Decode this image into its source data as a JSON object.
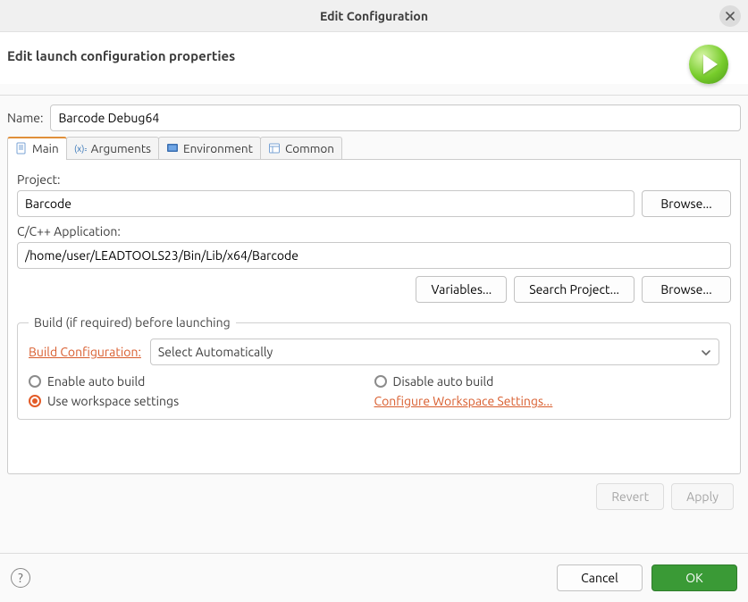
{
  "window": {
    "title": "Edit Configuration",
    "subtitle": "Edit launch configuration properties"
  },
  "name": {
    "label": "Name:",
    "value": "Barcode Debug64"
  },
  "tabs": {
    "main": "Main",
    "arguments": "Arguments",
    "environment": "Environment",
    "common": "Common"
  },
  "main": {
    "project_label": "Project:",
    "project_value": "Barcode",
    "browse": "Browse...",
    "app_label": "C/C++ Application:",
    "app_value": "/home/user/LEADTOOLS23/Bin/Lib/x64/Barcode",
    "btn_variables": "Variables...",
    "btn_search": "Search Project...",
    "btn_browse2": "Browse...",
    "build_group": {
      "legend": "Build (if required) before launching",
      "build_config_label": "Build Configuration:",
      "build_config_value": "Select Automatically",
      "enable_auto": "Enable auto build",
      "disable_auto": "Disable auto build",
      "use_workspace": "Use workspace settings",
      "configure_link": "Configure Workspace Settings...",
      "selected": "use_workspace"
    }
  },
  "buttons": {
    "revert": "Revert",
    "apply": "Apply",
    "cancel": "Cancel",
    "ok": "OK"
  }
}
